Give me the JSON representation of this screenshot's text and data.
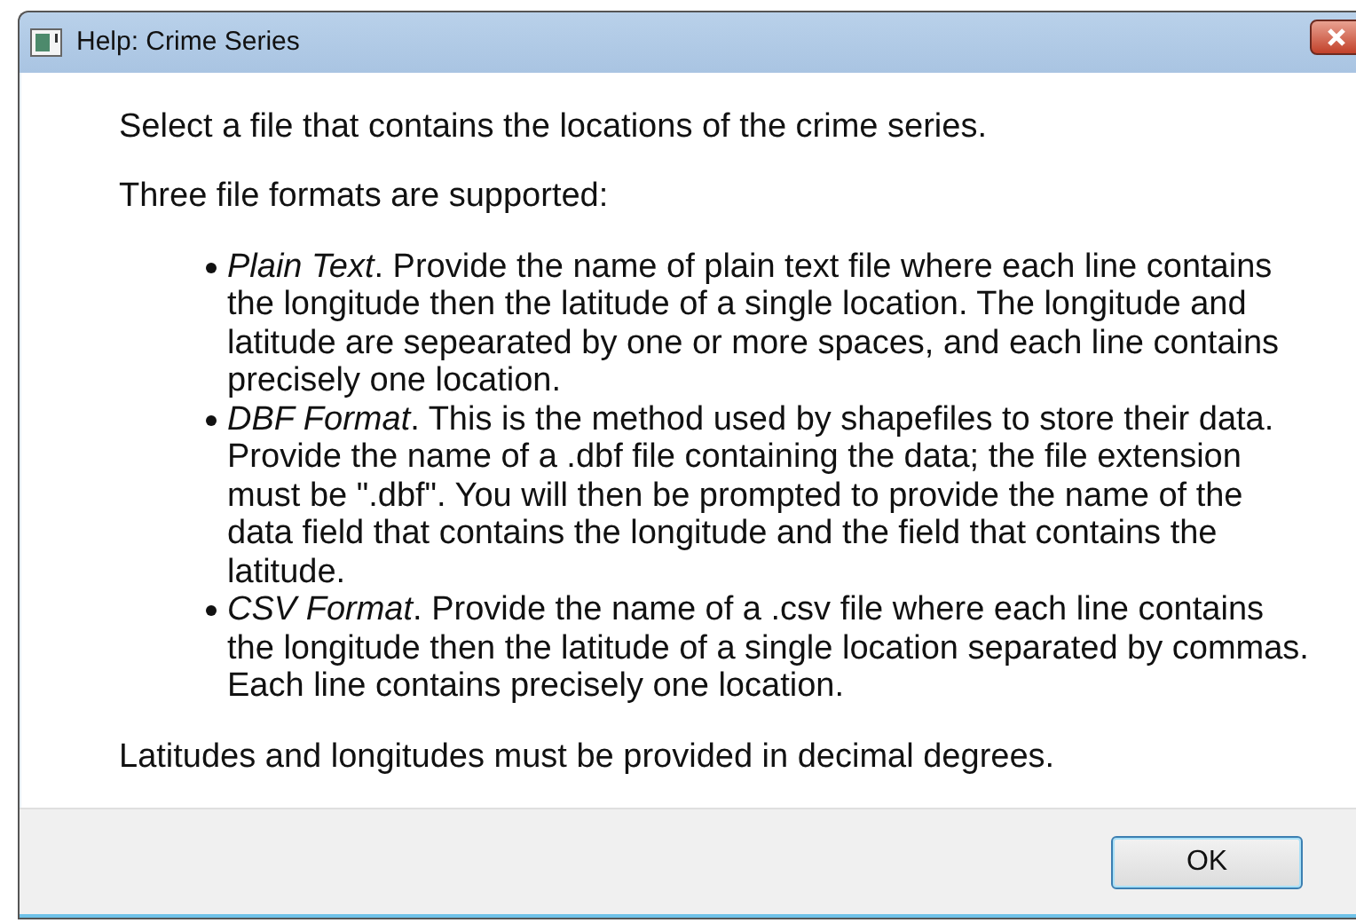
{
  "window": {
    "title": "Help: Crime Series"
  },
  "intro": "Select a file that contains the locations of the crime series.",
  "formats_heading": "Three file formats are supported:",
  "formats": [
    {
      "text": "*Plain Text*. Provide the name of plain text file where each line contains the longitude then the latitude of a single location. The longitude and latitude are sepearated by one or more spaces, and each line contains precisely one location."
    },
    {
      "text": "*DBF Format*. This is the method used by shapefiles to store their data. Provide the name of a .dbf file containing the data; the file extension must be \".dbf\". You will then be prompted to provide the name of the data field that contains the longitude and the field that contains the latitude."
    },
    {
      "text": "*CSV Format*. Provide the name of a .csv file where each line contains the longitude then the latitude of a single location separated by commas. Each line contains precisely one location."
    }
  ],
  "note": "Latitudes and longitudes must be provided in decimal degrees.",
  "buttons": [
    "OK"
  ]
}
